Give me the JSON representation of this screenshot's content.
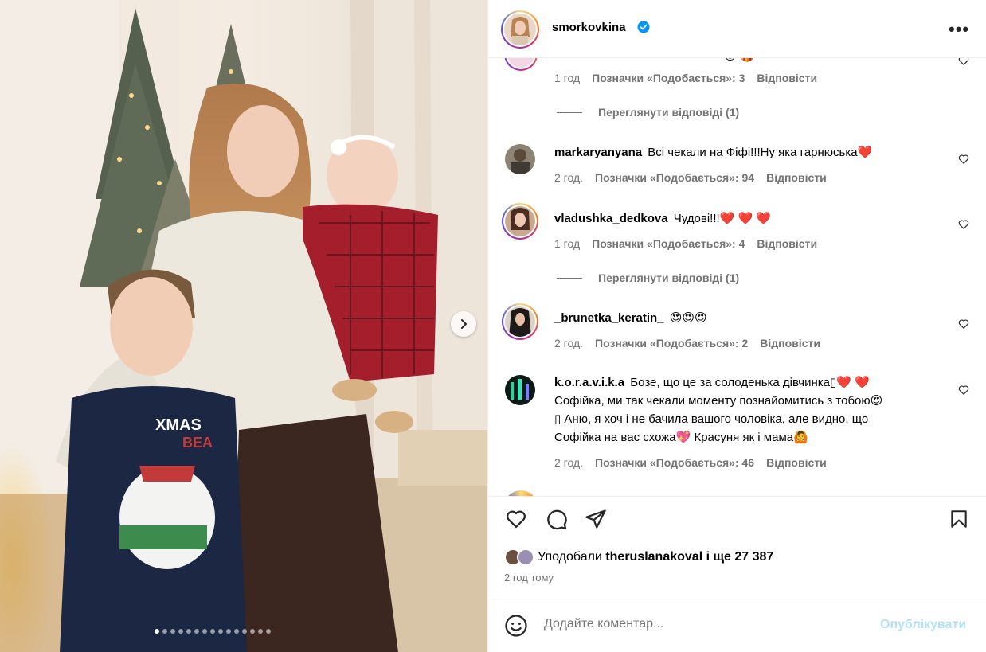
{
  "post": {
    "username": "smorkovkina",
    "more_label": "•••",
    "carousel_dot_count": 15,
    "active_dot_index": 0
  },
  "comments": [
    {
      "username": "",
      "text": "",
      "emoji": "😌 🎁",
      "time": "1 год",
      "likes": "Позначки «Подобається»: 3",
      "reply": "Відповісти"
    },
    {
      "username": "markaryanyana",
      "text": "Всі чекали на Фіфі!!!Ну яка гарнюська",
      "emoji": "❤️",
      "time": "2 год.",
      "likes": "Позначки «Подобається»: 94",
      "reply": "Відповісти"
    },
    {
      "username": "vladushka_dedkova",
      "text": "Чудові!!!",
      "emoji": "❤️ ❤️ ❤️",
      "time": "1 год",
      "likes": "Позначки «Подобається»: 4",
      "reply": "Відповісти"
    },
    {
      "username": "_brunetka_keratin_",
      "text": "",
      "emoji": "😍😍😍",
      "time": "2 год.",
      "likes": "Позначки «Подобається»: 2",
      "reply": "Відповісти"
    },
    {
      "username": "k.o.r.a.v.i.k.a",
      "text_lines": [
        "Бозе, що це за солоденька дівчинка▯❤️ ❤️",
        "Софійка, ми так чекали моменту познайомитись з тобою😍",
        "▯ Аню, я хоч і не бачила вашого чоловіка, але видно, що",
        "Софійка на вас схожа💖  Красуня як і мама🙆"
      ],
      "time": "2 год.",
      "likes": "Позначки «Подобається»: 46",
      "reply": "Відповісти"
    }
  ],
  "view_replies": [
    "Переглянути відповіді (1)",
    "Переглянути відповіді (1)"
  ],
  "likes_summary": {
    "prefix": "Уподобали",
    "user": "theruslanakoval",
    "suffix": "і ще 27 387"
  },
  "time_ago": "2 год тому",
  "comment_box": {
    "placeholder": "Додайте коментар...",
    "publish_label": "Опублікувати"
  },
  "colors": {
    "verified": "#0095f6",
    "publish_disabled": "#b2dffc",
    "meta_text": "#737373",
    "heart_red": "#ed1c24"
  },
  "icons": [
    "chevron-right-icon",
    "verified-badge-icon",
    "more-icon",
    "heart-icon",
    "comment-icon",
    "share-icon",
    "bookmark-icon",
    "emoji-icon"
  ]
}
